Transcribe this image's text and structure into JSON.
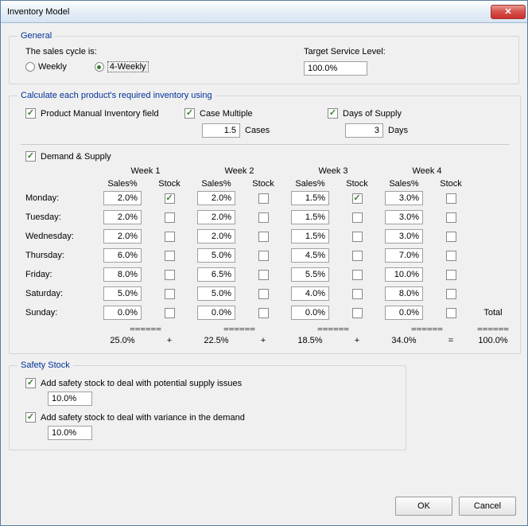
{
  "window": {
    "title": "Inventory Model",
    "close_glyph": "✕"
  },
  "general": {
    "legend": "General",
    "sales_cycle_label": "The sales cycle is:",
    "weekly_label": "Weekly",
    "four_weekly_label": "4-Weekly",
    "selected": "four_weekly",
    "tsl_label": "Target Service Level:",
    "tsl_value": "100.0%"
  },
  "calc": {
    "legend": "Calculate each product's required inventory using",
    "pmif": {
      "label": "Product Manual Inventory field",
      "checked": true
    },
    "case_multiple": {
      "label": "Case Multiple",
      "checked": true,
      "value": "1.5",
      "unit": "Cases"
    },
    "days_supply": {
      "label": "Days of Supply",
      "checked": true,
      "value": "3",
      "unit": "Days"
    },
    "demand_supply": {
      "label": "Demand & Supply",
      "checked": true
    }
  },
  "grid": {
    "weeks": [
      "Week 1",
      "Week 2",
      "Week 3",
      "Week 4"
    ],
    "sub": {
      "sales": "Sales%",
      "stock": "Stock"
    },
    "days": [
      "Monday:",
      "Tuesday:",
      "Wednesday:",
      "Thursday:",
      "Friday:",
      "Saturday:",
      "Sunday:"
    ],
    "total_label": "Total",
    "sep": "======",
    "cells": [
      [
        {
          "s": "2.0%",
          "k": true
        },
        {
          "s": "2.0%",
          "k": false
        },
        {
          "s": "1.5%",
          "k": true
        },
        {
          "s": "3.0%",
          "k": false
        }
      ],
      [
        {
          "s": "2.0%",
          "k": false
        },
        {
          "s": "2.0%",
          "k": false
        },
        {
          "s": "1.5%",
          "k": false
        },
        {
          "s": "3.0%",
          "k": false
        }
      ],
      [
        {
          "s": "2.0%",
          "k": false
        },
        {
          "s": "2.0%",
          "k": false
        },
        {
          "s": "1.5%",
          "k": false
        },
        {
          "s": "3.0%",
          "k": false
        }
      ],
      [
        {
          "s": "6.0%",
          "k": false
        },
        {
          "s": "5.0%",
          "k": false
        },
        {
          "s": "4.5%",
          "k": false
        },
        {
          "s": "7.0%",
          "k": false
        }
      ],
      [
        {
          "s": "8.0%",
          "k": false
        },
        {
          "s": "6.5%",
          "k": false
        },
        {
          "s": "5.5%",
          "k": false
        },
        {
          "s": "10.0%",
          "k": false
        }
      ],
      [
        {
          "s": "5.0%",
          "k": false
        },
        {
          "s": "5.0%",
          "k": false
        },
        {
          "s": "4.0%",
          "k": false
        },
        {
          "s": "8.0%",
          "k": false
        }
      ],
      [
        {
          "s": "0.0%",
          "k": false
        },
        {
          "s": "0.0%",
          "k": false
        },
        {
          "s": "0.0%",
          "k": false
        },
        {
          "s": "0.0%",
          "k": false
        }
      ]
    ],
    "totals": {
      "w": [
        "25.0%",
        "22.5%",
        "18.5%",
        "34.0%"
      ],
      "ops": [
        "+",
        "+",
        "+",
        "="
      ],
      "grand": "100.0%"
    }
  },
  "safety": {
    "legend": "Safety Stock",
    "supply": {
      "label": "Add safety stock to deal with potential supply issues",
      "checked": true,
      "value": "10.0%"
    },
    "demand": {
      "label": "Add safety stock to deal with variance in the demand",
      "checked": true,
      "value": "10.0%"
    }
  },
  "buttons": {
    "ok": "OK",
    "cancel": "Cancel"
  }
}
